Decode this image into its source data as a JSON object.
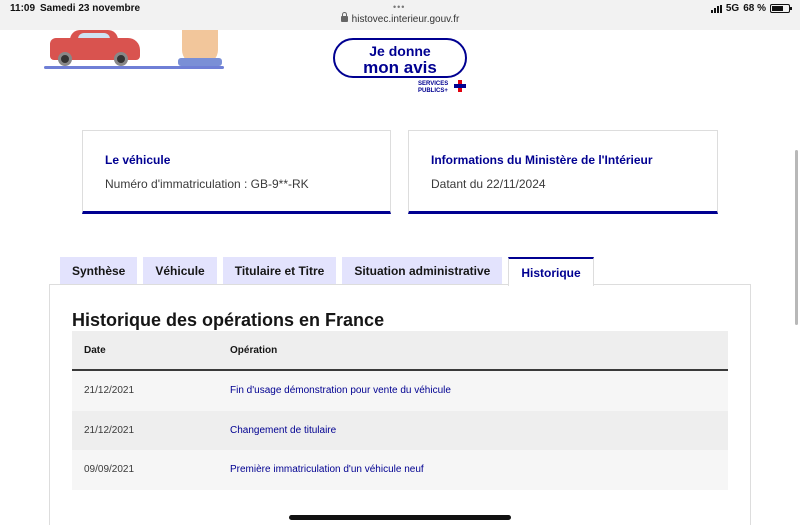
{
  "status_bar": {
    "time": "11:09",
    "date": "Samedi 23 novembre",
    "dots": "•••",
    "url": "histovec.interieur.gouv.fr",
    "network": "5G",
    "battery": "68 %",
    "battery_level_percent": 68
  },
  "avis_button": {
    "line1": "Je donne",
    "line2": "mon avis"
  },
  "services_publics": {
    "line1": "SERVICES",
    "line2": "PUBLICS+"
  },
  "cards": [
    {
      "title": "Le véhicule",
      "text": "Numéro d'immatriculation : GB-9**-RK"
    },
    {
      "title": "Informations du Ministère de l'Intérieur",
      "text": "Datant du 22/11/2024"
    }
  ],
  "tabs": [
    {
      "label": "Synthèse",
      "active": false
    },
    {
      "label": "Véhicule",
      "active": false
    },
    {
      "label": "Titulaire et Titre",
      "active": false
    },
    {
      "label": "Situation administrative",
      "active": false
    },
    {
      "label": "Historique",
      "active": true
    }
  ],
  "history": {
    "title": "Historique des opérations en France",
    "columns": {
      "date": "Date",
      "operation": "Opération"
    },
    "rows": [
      {
        "date": "21/12/2021",
        "operation": "Fin d'usage démonstration pour vente du véhicule"
      },
      {
        "date": "21/12/2021",
        "operation": "Changement de titulaire"
      },
      {
        "date": "09/09/2021",
        "operation": "Première immatriculation d'un véhicule neuf"
      }
    ]
  },
  "colors": {
    "primary": "#000091",
    "tab_background": "#e3e3fd",
    "table_header": "#eeeeee",
    "brand_red": "#e1000f"
  }
}
